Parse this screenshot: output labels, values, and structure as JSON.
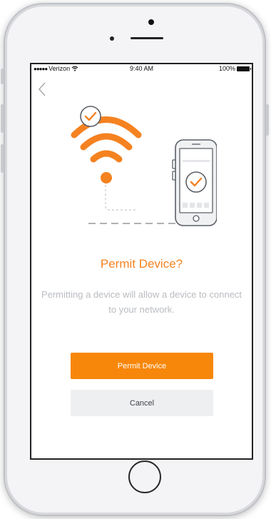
{
  "status_bar": {
    "signal": "●●●●●",
    "carrier": "Verizon",
    "time": "9:40 AM",
    "battery_text": "100%"
  },
  "screen": {
    "title": "Permit Device?",
    "description": "Permitting a device will allow a device to connect to your network.",
    "primary_button": "Permit Device",
    "secondary_button": "Cancel"
  },
  "icons": {
    "back": "chevron-left-icon",
    "wifi": "wifi-icon",
    "phone": "phone-icon",
    "check": "checkmark-icon"
  },
  "colors": {
    "accent": "#f58220",
    "button_primary": "#f7870a",
    "button_secondary": "#eeeff1",
    "text_muted": "#b9bcc1"
  }
}
